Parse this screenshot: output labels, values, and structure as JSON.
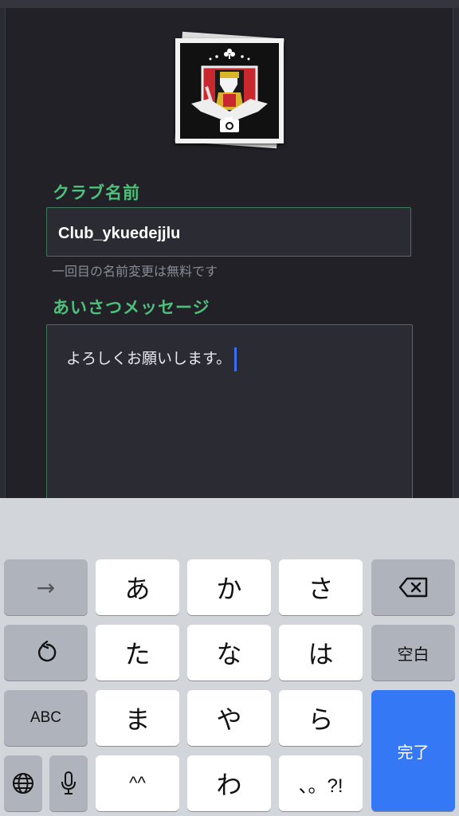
{
  "profile": {
    "avatar_icon": "jack-of-clubs-card-icon",
    "camera_icon": "camera-icon"
  },
  "form": {
    "club_name_label": "クラブ名前",
    "club_name_value": "Club_ykuedejjlu",
    "club_name_hint": "一回目の名前変更は無料です",
    "greeting_label": "あいさつメッセージ",
    "greeting_value": "よろしくお願いします。"
  },
  "keyboard": {
    "row1": [
      "あ",
      "か",
      "さ"
    ],
    "row2": [
      "た",
      "な",
      "は"
    ],
    "row3": [
      "ま",
      "や",
      "ら"
    ],
    "row4": [
      "^^",
      "わ",
      "、。?!"
    ],
    "space_label": "空白",
    "abc_label": "ABC",
    "done_label": "完了",
    "arrow_label": "→",
    "icons": {
      "delete": "backspace-icon",
      "undo": "undo-icon",
      "globe": "globe-icon",
      "mic": "microphone-icon"
    },
    "done_color": "#3478f6"
  },
  "colors": {
    "accent_green": "#4ec07a",
    "background": "#212127"
  }
}
